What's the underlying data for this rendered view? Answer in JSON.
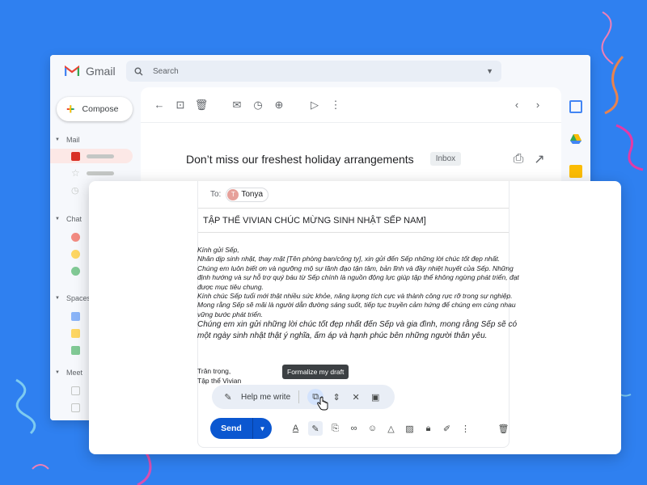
{
  "app": {
    "name": "Gmail"
  },
  "search": {
    "placeholder": "Search"
  },
  "sidebar": {
    "compose_label": "Compose",
    "sections": {
      "mail": "Mail",
      "chat": "Chat",
      "spaces": "Spaces",
      "meet": "Meet"
    }
  },
  "email": {
    "subject": "Don’t miss our freshest holiday arrangements",
    "label": "Inbox"
  },
  "compose": {
    "to_label": "To:",
    "recipient_initial": "T",
    "recipient_name": "Tonya",
    "subject": "TẬP THỂ VIVIAN CHÚC MỪNG SINH NHẬT SẾP NAM]",
    "body": [
      "Kính gửi Sếp,",
      "Nhân dịp sinh nhật, thay mặt [Tên phòng ban/công ty], xin gửi đến Sếp những lời chúc tốt đẹp nhất.",
      "Chúng em luôn biết ơn và ngưỡng mộ sự lãnh đạo tận tâm, bản lĩnh và đầy nhiệt huyết của Sếp. Những định hướng và sự hỗ trợ quý báu từ Sếp chính là nguồn động lực giúp tập thể không ngừng phát triển, đạt được mục tiêu chung.",
      "Kính chúc Sếp tuổi mới thật nhiều sức khỏe, năng lượng tích cực và thành công rực rỡ trong sự nghiệp. Mong rằng Sếp sẽ mãi là người dẫn đường sáng suốt, tiếp tục truyền cảm hứng để chúng em cùng nhau vững bước phát triển.",
      "Chúng em xin gửi những lời chúc tốt đẹp nhất đến Sếp và gia đình, mong rằng Sếp sẽ có một ngày sinh nhật thật ý nghĩa, ấm áp và hạnh phúc bên những người thân yêu."
    ],
    "closing": "Trân trọng,",
    "signature": "Tập thể Vivian",
    "tooltip": "Formalize my draft",
    "help_me_write": "Help me write",
    "send_label": "Send"
  },
  "colors": {
    "background": "#2f80f0",
    "send": "#0b57d0"
  }
}
